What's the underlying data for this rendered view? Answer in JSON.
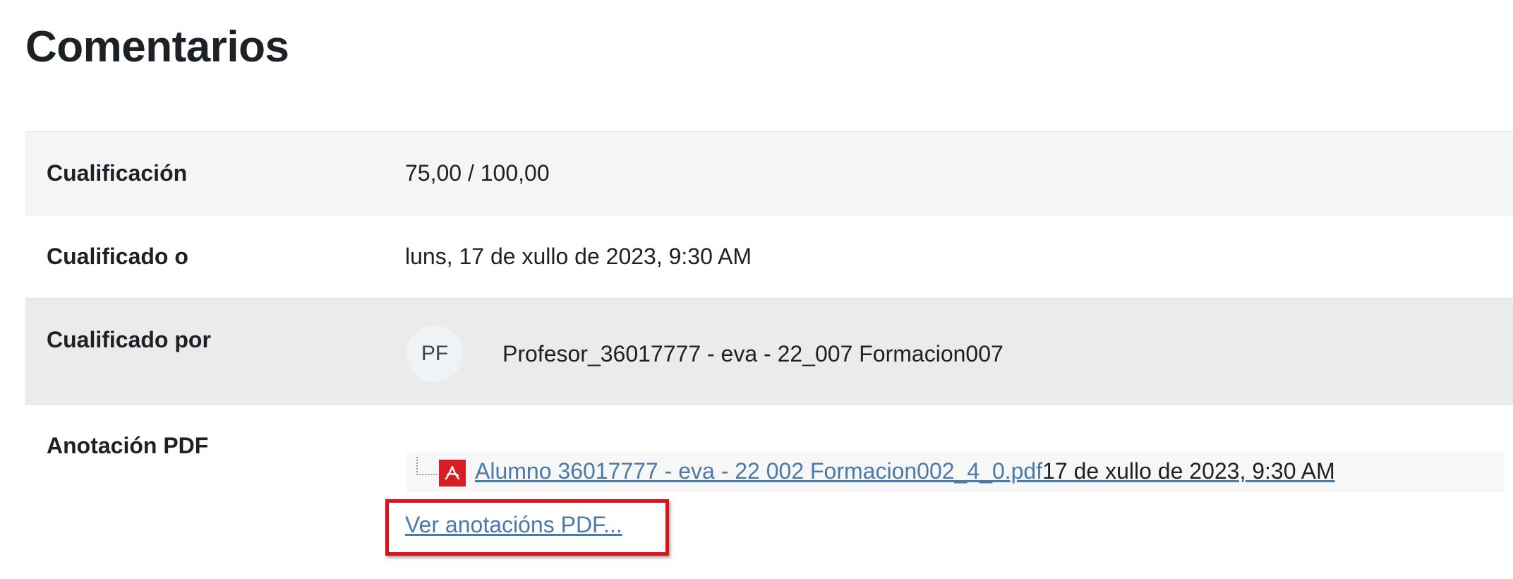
{
  "heading": "Comentarios",
  "rows": {
    "grade": {
      "label": "Cualificación",
      "value": "75,00 / 100,00"
    },
    "graded_on": {
      "label": "Cualificado o",
      "value": "luns, 17 de xullo de 2023, 9:30 AM"
    },
    "graded_by": {
      "label": "Cualificado por",
      "avatar_initials": "PF",
      "name": "Profesor_36017777 - eva - 22_007 Formacion007"
    },
    "pdf_annotation": {
      "label": "Anotación PDF",
      "file_icon": "pdf-icon",
      "file_name": "Alumno 36017777 - eva - 22 002 Formacion002_4_0.pdf",
      "file_date": "17 de xullo de 2023, 9:30 AM",
      "view_link": "Ver anotacións PDF..."
    }
  },
  "colors": {
    "link": "#4a7aa8",
    "highlight_box": "#e0101a",
    "pdf_icon": "#d71e22"
  }
}
